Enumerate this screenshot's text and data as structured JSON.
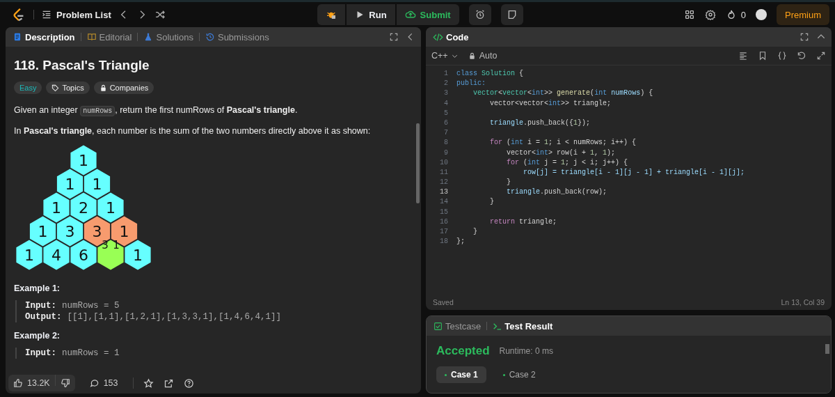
{
  "top_bar": {
    "problem_list": "Problem List",
    "run": "Run",
    "submit": "Submit",
    "streak": "0",
    "premium": "Premium"
  },
  "description_panel": {
    "tabs": [
      {
        "label": "Description",
        "selected": true
      },
      {
        "label": "Editorial",
        "selected": false
      },
      {
        "label": "Solutions",
        "selected": false
      },
      {
        "label": "Submissions",
        "selected": false
      }
    ],
    "title": "118. Pascal's Triangle",
    "tags": [
      {
        "label": "Easy",
        "kind": "difficulty"
      },
      {
        "label": "Topics",
        "kind": "topics"
      },
      {
        "label": "Companies",
        "kind": "companies"
      }
    ],
    "paragraphs": [
      [
        {
          "kind": "text",
          "text": "Given an integer "
        },
        {
          "kind": "code",
          "text": "numRows"
        },
        {
          "kind": "text",
          "text": ", return the first numRows of **Pascal's triangle**."
        }
      ],
      [
        {
          "kind": "text",
          "text": "In **Pascal's triangle**, each number is the sum of the two numbers directly above it as shown:"
        }
      ]
    ],
    "figure": {
      "rows": [
        [
          {
            "v": "1",
            "color": "#66ffff"
          }
        ],
        [
          {
            "v": "1",
            "color": "#66ffff"
          },
          {
            "v": "1",
            "color": "#66ffff"
          }
        ],
        [
          {
            "v": "1",
            "color": "#66ffff"
          },
          {
            "v": "2",
            "color": "#66ffff"
          },
          {
            "v": "1",
            "color": "#66ffff"
          }
        ],
        [
          {
            "v": "1",
            "color": "#66ffff"
          },
          {
            "v": "3",
            "color": "#66ffff"
          },
          {
            "v": "3",
            "color": "#f79b6e"
          },
          {
            "v": "1",
            "color": "#f79b6e"
          }
        ],
        [
          {
            "v": "1",
            "color": "#66ffff"
          },
          {
            "v": "4",
            "color": "#66ffff"
          },
          {
            "v": "6",
            "color": "#66ffff"
          },
          {
            "color": "#99ff55",
            "incoming": [
              "3",
              "1"
            ]
          },
          {
            "v": "1",
            "color": "#66ffff"
          }
        ]
      ]
    },
    "examples": [
      {
        "heading": "Example 1:",
        "input_label": "Input:",
        "input": "numRows = 5",
        "output_label": "Output:",
        "output": "[[1],[1,1],[1,2,1],[1,3,3,1],[1,4,6,4,1]]"
      },
      {
        "heading": "Example 2:",
        "input_label": "Input:",
        "input": "numRows = 1"
      }
    ],
    "footer": {
      "likes": "13.2K",
      "comments": "153"
    }
  },
  "code_panel": {
    "title": "Code",
    "language": "C++",
    "mode": "Auto",
    "status": "Saved",
    "cursor": "Ln 13, Col 39",
    "lines": [
      {
        "n": "1",
        "current": false,
        "tokens": [
          {
            "t": "class ",
            "kind": "kw"
          },
          {
            "t": "Solution",
            "kind": "type"
          },
          {
            "t": " {",
            "kind": "p"
          }
        ]
      },
      {
        "n": "2",
        "current": false,
        "tokens": [
          {
            "t": "public:",
            "kind": "kw"
          }
        ]
      },
      {
        "n": "3",
        "current": false,
        "tokens": [
          {
            "t": "    vector",
            "kind": "type"
          },
          {
            "t": "<",
            "kind": "p"
          },
          {
            "t": "vector",
            "kind": "type"
          },
          {
            "t": "<",
            "kind": "p"
          },
          {
            "t": "int",
            "kind": "kw"
          },
          {
            "t": ">> ",
            "kind": "p"
          },
          {
            "t": "generate",
            "kind": "fn"
          },
          {
            "t": "(",
            "kind": "p"
          },
          {
            "t": "int ",
            "kind": "kw"
          },
          {
            "t": "numRows",
            "kind": "var"
          },
          {
            "t": ") {",
            "kind": "p"
          }
        ]
      },
      {
        "n": "4",
        "current": false,
        "tokens": [
          {
            "t": "        vector<vector<",
            "kind": "p"
          },
          {
            "t": "int",
            "kind": "kw"
          },
          {
            "t": ">> triangle;",
            "kind": "p"
          }
        ]
      },
      {
        "n": "5",
        "current": false
      },
      {
        "n": "6",
        "current": false,
        "tokens": [
          {
            "t": "        triangle",
            "kind": "var"
          },
          {
            "t": ".push_back({",
            "kind": "p"
          },
          {
            "t": "1",
            "kind": "num"
          },
          {
            "t": "});",
            "kind": "p"
          }
        ]
      },
      {
        "n": "7",
        "current": false
      },
      {
        "n": "8",
        "current": false,
        "tokens": [
          {
            "t": "        for",
            "kind": "ctrl"
          },
          {
            "t": " (",
            "kind": "p"
          },
          {
            "t": "int",
            "kind": "kw"
          },
          {
            "t": " i = ",
            "kind": "p"
          },
          {
            "t": "1",
            "kind": "num"
          },
          {
            "t": "; i < numRows; i++) {",
            "kind": "p"
          }
        ]
      },
      {
        "n": "9",
        "current": false,
        "tokens": [
          {
            "t": "            vector<",
            "kind": "p"
          },
          {
            "t": "int",
            "kind": "kw"
          },
          {
            "t": "> row(i + ",
            "kind": "p"
          },
          {
            "t": "1",
            "kind": "num"
          },
          {
            "t": ", ",
            "kind": "p"
          },
          {
            "t": "1",
            "kind": "num"
          },
          {
            "t": ");",
            "kind": "p"
          }
        ]
      },
      {
        "n": "10",
        "current": false,
        "tokens": [
          {
            "t": "            for",
            "kind": "ctrl"
          },
          {
            "t": " (",
            "kind": "p"
          },
          {
            "t": "int",
            "kind": "kw"
          },
          {
            "t": " j = ",
            "kind": "p"
          },
          {
            "t": "1",
            "kind": "num"
          },
          {
            "t": "; j < i; j++) {",
            "kind": "p"
          }
        ]
      },
      {
        "n": "11",
        "current": false,
        "tokens": [
          {
            "t": "                row[j] = triangle[i - 1][j - 1] + triangle[i - 1][j];",
            "kind": "var"
          }
        ]
      },
      {
        "n": "12",
        "current": false,
        "tokens": [
          {
            "t": "            }",
            "kind": "p"
          }
        ]
      },
      {
        "n": "13",
        "current": true,
        "tokens": [
          {
            "t": "            triangle",
            "kind": "var"
          },
          {
            "t": ".push_back(row);",
            "kind": "p"
          }
        ]
      },
      {
        "n": "14",
        "current": false,
        "tokens": [
          {
            "t": "        }",
            "kind": "p"
          }
        ]
      },
      {
        "n": "15",
        "current": false
      },
      {
        "n": "16",
        "current": false,
        "tokens": [
          {
            "t": "        return",
            "kind": "ctrl"
          },
          {
            "t": " triangle;",
            "kind": "p"
          }
        ]
      },
      {
        "n": "17",
        "current": false,
        "tokens": [
          {
            "t": "    }",
            "kind": "p"
          }
        ]
      },
      {
        "n": "18",
        "current": false,
        "tokens": [
          {
            "t": "};",
            "kind": "p"
          }
        ]
      }
    ]
  },
  "test_panel": {
    "tabs": [
      {
        "label": "Testcase",
        "selected": false
      },
      {
        "label": "Test Result",
        "selected": true
      }
    ],
    "verdict": "Accepted",
    "runtime": "Runtime: 0 ms",
    "cases": [
      {
        "label": "Case 1",
        "selected": true,
        "passed": true
      },
      {
        "label": "Case 2",
        "selected": false,
        "passed": true
      }
    ]
  }
}
